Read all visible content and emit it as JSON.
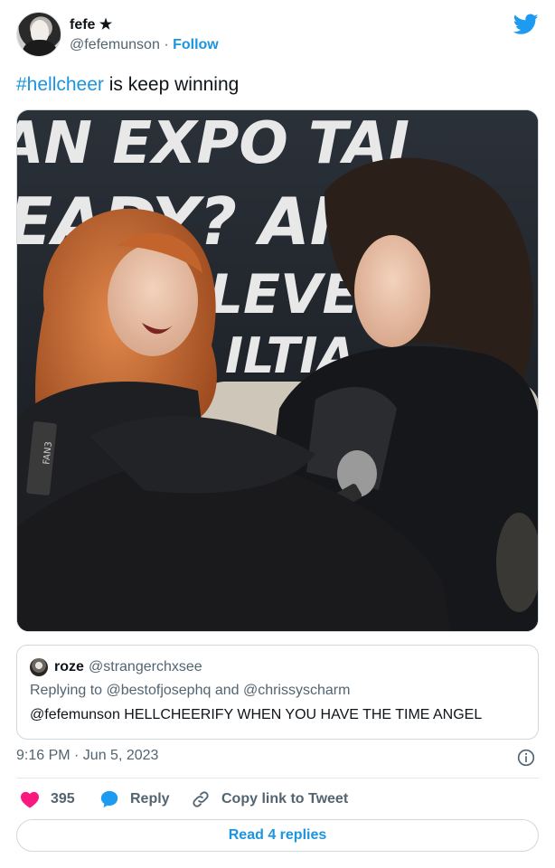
{
  "author": {
    "display_name": "fefe ★",
    "handle": "@fefemunson",
    "separator": "·",
    "follow_label": "Follow"
  },
  "tweet": {
    "hashtag": "#hellcheer",
    "text_rest": " is keep winning",
    "timestamp": "9:16 PM · Jun 5, 2023"
  },
  "photo": {
    "banner_lines": [
      "AN EXPO TAI",
      "EADY? AR",
      "T LEVE",
      "ILTIA"
    ],
    "badge_text": "FAN3"
  },
  "quote": {
    "name": "roze",
    "handle": "@strangerchxsee",
    "replying_to": "Replying to @bestofjosephq and @chrissyscharm",
    "text": "@fefemunson HELLCHEERIFY WHEN YOU HAVE THE TIME ANGEL"
  },
  "actions": {
    "like_count": "395",
    "reply_label": "Reply",
    "copy_label": "Copy link to Tweet",
    "read_replies_label": "Read 4 replies"
  },
  "colors": {
    "link": "#1b95e0",
    "like": "#f91880",
    "twitter_blue": "#1d9bf0",
    "secondary_text": "#536471"
  }
}
